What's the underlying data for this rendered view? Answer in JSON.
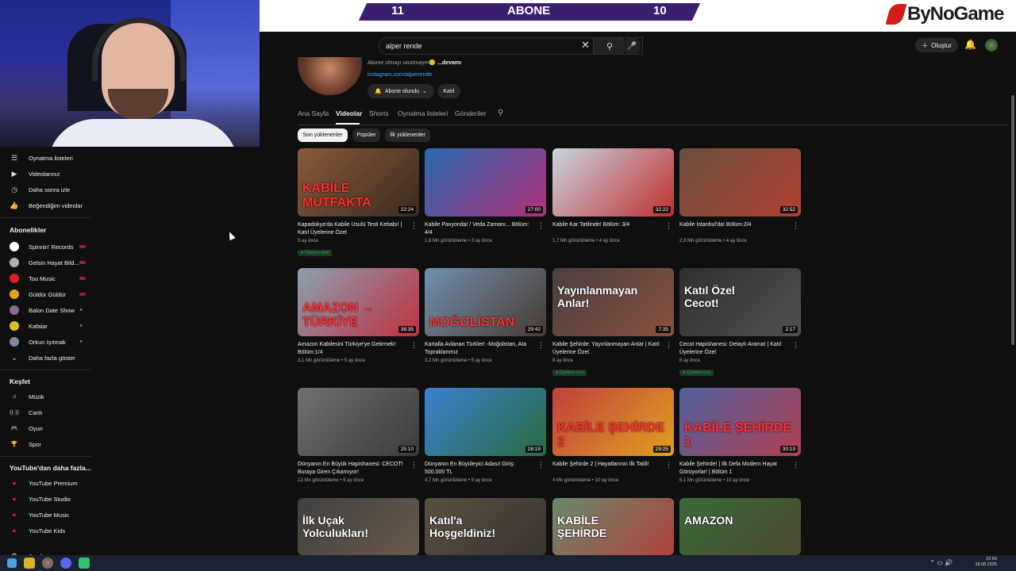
{
  "overlay": {
    "score_left": "11",
    "score_label": "ABONE",
    "score_right": "10",
    "logo_text": "ByNoGame"
  },
  "topbar": {
    "search_value": "alper rende",
    "create_label": "Oluştur"
  },
  "sidebar": {
    "top_items": [
      {
        "label": "Oynatma listeleri",
        "icon": "playlist-icon"
      },
      {
        "label": "Videolarınız",
        "icon": "video-icon"
      },
      {
        "label": "Daha sonra izle",
        "icon": "clock-icon"
      },
      {
        "label": "Beğendiğim videolar",
        "icon": "thumbs-up-icon"
      }
    ],
    "subs_heading": "Abonelikler",
    "subs": [
      {
        "label": "Spinnin' Records",
        "color": "#ffffff"
      },
      {
        "label": "Gelsin Hayat Bild...",
        "color": "#b0b0b0"
      },
      {
        "label": "Too Music",
        "color": "#d81f26"
      },
      {
        "label": "Güldür Güldür",
        "color": "#e8a020"
      },
      {
        "label": "Balon Date Show",
        "color": "#8a6a9a"
      },
      {
        "label": "Kafalar",
        "color": "#e0c020"
      },
      {
        "label": "Orkun Işıtmak",
        "color": "#7a8aa0"
      }
    ],
    "show_more": "Daha fazla göster",
    "explore_heading": "Keşfet",
    "explore": [
      {
        "label": "Müzik",
        "icon": "music-icon"
      },
      {
        "label": "Canlı",
        "icon": "live-icon"
      },
      {
        "label": "Oyun",
        "icon": "gaming-icon"
      },
      {
        "label": "Spor",
        "icon": "trophy-icon"
      }
    ],
    "more_heading": "YouTube'dan daha fazla...",
    "more": [
      {
        "label": "YouTube Premium"
      },
      {
        "label": "YouTube Studio"
      },
      {
        "label": "YouTube Music"
      },
      {
        "label": "YouTube Kids"
      }
    ],
    "settings": "Ayarlar"
  },
  "channel": {
    "desc": "Abone olmayı unutmayın😊",
    "desc_more": "...devamı",
    "link": "instagram.com/alperrende",
    "sub_label": "Abone olundu",
    "join_label": "Katıl"
  },
  "tabs": [
    "Ana Sayfa",
    "Videolar",
    "Shorts",
    "Oynatma listeleri",
    "Gönderiler"
  ],
  "chips": [
    "Son yüklenenler",
    "Popüler",
    "İlk yüklenenler"
  ],
  "videos": [
    {
      "title": "Kapadokya'da Kabile Usulü Testi Kebabı! | Katıl Üyelerine Özel",
      "meta": "3 ay önce",
      "duration": "22:24",
      "badge": "Üyelere özel",
      "overlay": "KABİLE MUTFAKTA",
      "c1": "#8a5a3a",
      "c2": "#3a2a20"
    },
    {
      "title": "Kabile Pavyonda! / Veda Zamanı... Bölüm: 4/4",
      "meta": "1,8 Mn görüntüleme • 3 ay önce",
      "duration": "27:00",
      "badge": "",
      "overlay": "",
      "c1": "#2a6ab0",
      "c2": "#b0307a"
    },
    {
      "title": "Kabile Kar Tatilinde! Bölüm: 3/4",
      "meta": "1,7 Mn görüntüleme • 4 ay önce",
      "duration": "32:22",
      "badge": "",
      "overlay": "",
      "c1": "#c8d4e0",
      "c2": "#c03030"
    },
    {
      "title": "Kabile İstanbul'da! Bölüm:2/4",
      "meta": "2,3 Mn görüntüleme • 4 ay önce",
      "duration": "32:52",
      "badge": "",
      "overlay": "",
      "c1": "#6a5040",
      "c2": "#b04030"
    },
    {
      "title": "Amazon Kabilesini Türkiye'ye Getirmek! Bölüm:1/4",
      "meta": "3,1 Mn görüntüleme • 5 ay önce",
      "duration": "38:35",
      "badge": "",
      "overlay": "AMAZON → TÜRKİYE",
      "c1": "#8aa0b0",
      "c2": "#c03040"
    },
    {
      "title": "Kartalla Avlanan Türkler! -Moğolistan, Ata Topraklarımız",
      "meta": "3,2 Mn görüntüleme • 5 ay önce",
      "duration": "29:42",
      "badge": "",
      "overlay": "MOĞOLİSTAN",
      "c1": "#7090b0",
      "c2": "#4a3a30"
    },
    {
      "title": "Kabile Şehirde: Yayınlanmayan Anlar | Katıl Üyelerine Özel",
      "meta": "8 ay önce",
      "duration": "7:35",
      "badge": "Üyelere özel",
      "overlay": "Yayınlanmayan Anlar!",
      "c1": "#4a4040",
      "c2": "#8a5040"
    },
    {
      "title": "Cecot Hapishanesi: Detaylı Arama! | Katıl Üyelerine Özel",
      "meta": "8 ay önce",
      "duration": "2:17",
      "badge": "Üyelere özel",
      "overlay": "Katıl Özel Cecot!",
      "c1": "#303030",
      "c2": "#505050"
    },
    {
      "title": "Dünyanın En Büyük Hapishanesi: CECOT! Buraya Giren Çıkamıyor!",
      "meta": "13 Mn görüntüleme • 9 ay önce",
      "duration": "25:10",
      "badge": "",
      "overlay": "",
      "c1": "#707070",
      "c2": "#3a3a3a"
    },
    {
      "title": "Dünyanın En Büyüleyici Adası! Giriş: 500.000 TL",
      "meta": "4,7 Mn görüntüleme • 9 ay önce",
      "duration": "28:19",
      "badge": "",
      "overlay": "",
      "c1": "#3a80d0",
      "c2": "#2a6a40"
    },
    {
      "title": "Kabile Şehirde 2 | Hayatlarının İlk Tatili!",
      "meta": "4 Mn görüntüleme • 10 ay önce",
      "duration": "29:25",
      "badge": "",
      "overlay": "KABİLE ŞEHİRDE 2",
      "c1": "#c04040",
      "c2": "#e0a020"
    },
    {
      "title": "Kabile Şehirde! | İlk Defa Modern Hayat Görüyorlar! | Bölüm 1",
      "meta": "6,1 Mn görüntüleme • 10 ay önce",
      "duration": "30:13",
      "badge": "",
      "overlay": "KABİLE ŞEHİRDE 1",
      "c1": "#5060a0",
      "c2": "#b04050"
    },
    {
      "title": "",
      "meta": "",
      "duration": "",
      "badge": "",
      "overlay": "İlk Uçak Yolculukları!",
      "c1": "#404040",
      "c2": "#6a5a4a"
    },
    {
      "title": "",
      "meta": "",
      "duration": "",
      "badge": "",
      "overlay": "Katıl'a Hoşgeldiniz!",
      "c1": "#5a5040",
      "c2": "#3a3430"
    },
    {
      "title": "",
      "meta": "",
      "duration": "",
      "badge": "",
      "overlay": "KABİLE ŞEHİRDE",
      "c1": "#6a8a6a",
      "c2": "#b04040"
    },
    {
      "title": "",
      "meta": "",
      "duration": "",
      "badge": "",
      "overlay": "AMAZON",
      "c1": "#3a6a3a",
      "c2": "#4a4a30"
    }
  ],
  "tray": {
    "time": "22:59",
    "date": "18.08.2025"
  }
}
